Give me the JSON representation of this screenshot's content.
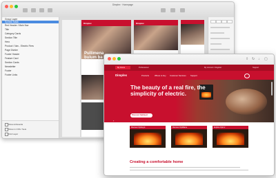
{
  "sketch": {
    "title": "Dimplex · Homepage",
    "layers": [
      "Group Layer",
      "Symbol Mask",
      "Red Header / Main Nav",
      "Title",
      "Category Cards",
      "Section Title",
      "Hero",
      "Product / Nav - Electric Fires",
      "Page Divider",
      "Footer Header",
      "Feature Card",
      "Section Cards",
      "Newsletter",
      "Footer",
      "Footer Links"
    ],
    "options": [
      "Show Artboards",
      "Show in CSS / Sets",
      "Find Layer"
    ],
    "artboard_text_1": "Pullimena bulum ba",
    "artboard_text_2": "Vi",
    "artboard_logo": "Dimplex"
  },
  "browser": {
    "topbar": {
      "home_tab": "My Home",
      "professional": "Professional",
      "account": "My Account / Register",
      "right_label": "Support"
    },
    "nav": {
      "logo": "Dimplex",
      "items": [
        "Products",
        "Where to buy",
        "Customer Services",
        "Support"
      ]
    },
    "hero": {
      "title": "The beauty of a real fire, the simplicity of electric.",
      "button": "Discover Optimyst"
    },
    "cards": [
      {
        "label": "Discover Optimyst"
      },
      {
        "label": "Discover Optiflame"
      },
      {
        "label": "Explore Opti-V"
      }
    ],
    "section_title": "Creating a comfortable home"
  },
  "colors": {
    "brand_red": "#c8102e",
    "dark_red": "#a50d22",
    "selection_blue": "#4a8be0"
  }
}
